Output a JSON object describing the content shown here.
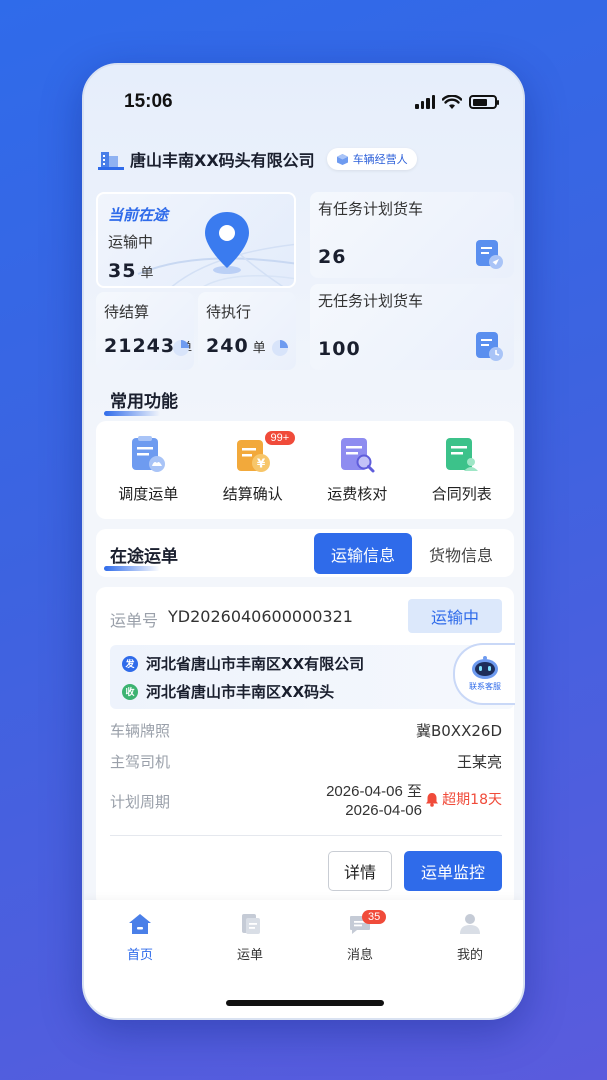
{
  "status_bar": {
    "time": "15:06"
  },
  "company": {
    "name": "唐山丰南XX码头有限公司",
    "role": "车辆经营人"
  },
  "stats": {
    "current": {
      "title": "当前在途",
      "label": "运输中",
      "value": "35",
      "unit": "单"
    },
    "pending_settle": {
      "label": "待结算",
      "value": "21243",
      "unit": "单"
    },
    "pending_exec": {
      "label": "待执行",
      "value": "240",
      "unit": "单"
    },
    "with_plan": {
      "label": "有任务计划货车",
      "value": "26"
    },
    "without_plan": {
      "label": "无任务计划货车",
      "value": "100"
    }
  },
  "common_functions": {
    "title": "常用功能",
    "items": [
      {
        "label": "调度运单",
        "icon": "dispatch-icon"
      },
      {
        "label": "结算确认",
        "icon": "settlement-icon",
        "badge": "99+"
      },
      {
        "label": "运费核对",
        "icon": "freight-check-icon"
      },
      {
        "label": "合同列表",
        "icon": "contract-icon"
      }
    ]
  },
  "in_transit": {
    "title": "在途运单",
    "tabs": [
      "运输信息",
      "货物信息"
    ],
    "active_tab": 0
  },
  "order": {
    "no_label": "运单号",
    "no": "YD2026040600000321",
    "status": "运输中",
    "from_tag": "发",
    "from": "河北省唐山市丰南区XX有限公司",
    "to_tag": "收",
    "to": "河北省唐山市丰南区XX码头",
    "cs_label": "联系客服",
    "plate_label": "车辆牌照",
    "plate": "冀B0XX26D",
    "driver_label": "主驾司机",
    "driver": "王某亮",
    "period_label": "计划周期",
    "period_start": "2026-04-06 至",
    "period_end": "2026-04-06",
    "overdue": "超期18天",
    "detail_btn": "详情",
    "monitor_btn": "运单监控"
  },
  "tabbar": {
    "items": [
      {
        "label": "首页",
        "icon": "home-icon",
        "active": true
      },
      {
        "label": "运单",
        "icon": "waybill-icon"
      },
      {
        "label": "消息",
        "icon": "message-icon",
        "badge": "35"
      },
      {
        "label": "我的",
        "icon": "profile-icon"
      }
    ]
  },
  "colors": {
    "primary": "#2F6BEA",
    "danger": "#F04B3A",
    "text": "#1A1F2E"
  }
}
